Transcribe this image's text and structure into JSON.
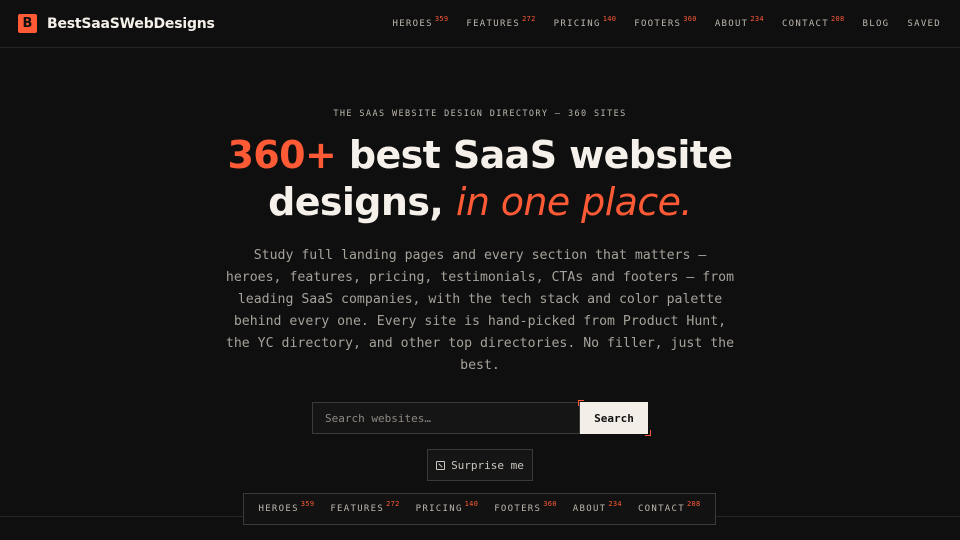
{
  "brand": {
    "mark": "B",
    "name": "BestSaaSWebDesigns"
  },
  "nav": [
    {
      "label": "HEROES",
      "count": "359"
    },
    {
      "label": "FEATURES",
      "count": "272"
    },
    {
      "label": "PRICING",
      "count": "140"
    },
    {
      "label": "FOOTERS",
      "count": "360"
    },
    {
      "label": "ABOUT",
      "count": "234"
    },
    {
      "label": "CONTACT",
      "count": "208"
    },
    {
      "label": "BLOG",
      "count": ""
    },
    {
      "label": "SAVED",
      "count": ""
    }
  ],
  "hero": {
    "eyebrow": "THE SAAS WEBSITE DESIGN DIRECTORY — 360 SITES",
    "headline_accent": "360+",
    "headline_main": " best SaaS website",
    "headline_line2": "designs, ",
    "headline_italic": "in one place.",
    "description": "Study full landing pages and every section that matters — heroes, features, pricing, testimonials, CTAs and footers — from leading SaaS companies, with the tech stack and color palette behind every one. Every site is hand-picked from Product Hunt, the YC directory, and other top directories. No filler, just the best."
  },
  "search": {
    "placeholder": "Search websites…",
    "button_label": "Search"
  },
  "surprise": {
    "label": "Surprise me",
    "icon": "dice-icon"
  },
  "pill_nav": [
    {
      "label": "HEROES",
      "count": "359"
    },
    {
      "label": "FEATURES",
      "count": "272"
    },
    {
      "label": "PRICING",
      "count": "140"
    },
    {
      "label": "FOOTERS",
      "count": "360"
    },
    {
      "label": "ABOUT",
      "count": "234"
    },
    {
      "label": "CONTACT",
      "count": "208"
    }
  ],
  "colors": {
    "background": "#0f0f0f",
    "accent": "#ff5a36",
    "text": "#f5f1ea",
    "muted": "#a6a19a"
  }
}
